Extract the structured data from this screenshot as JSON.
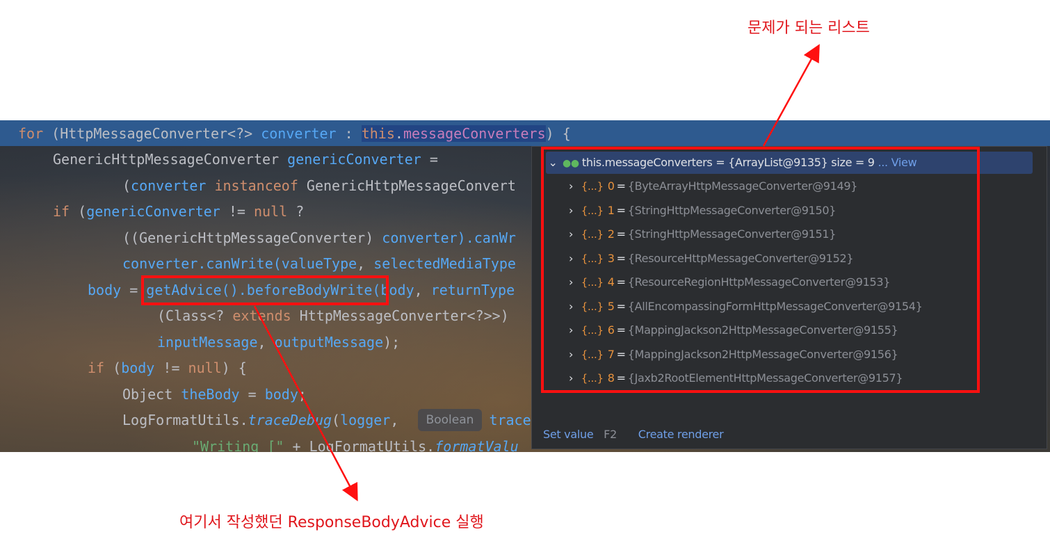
{
  "annotations": {
    "top_note": "문제가 되는 리스트",
    "bottom_note": "여기서 작성했던 ResponseBodyAdvice 실행"
  },
  "code": {
    "line1": {
      "kw": "for",
      "open": " (",
      "type": "HttpMessageConverter<?>",
      "var": " converter",
      "colon": " : ",
      "this": "this",
      "dot": ".",
      "field": "messageConverters",
      "close": ") {"
    },
    "line2": {
      "type": "GenericHttpMessageConverter",
      "var": " genericConverter",
      "rest": " ="
    },
    "line3": {
      "open": "(",
      "var": "converter",
      "kw": " instanceof",
      "type": " GenericHttpMessageConvert"
    },
    "line4": {
      "kw": "if",
      "open": " (",
      "var": "genericConverter",
      "op": " != ",
      "null": "null",
      "rest": " ?"
    },
    "line5": {
      "open": "((",
      "type": "GenericHttpMessageConverter",
      "close": ")",
      "var": " converter",
      "rest": ").canWr"
    },
    "line6": {
      "var": "converter",
      "rest": ".canWrite(",
      "arg1": "valueType",
      "comma": ", ",
      "arg2": "selectedMediaType"
    },
    "line7": {
      "var": "body",
      "eq": " = ",
      "call": "getAdvice().beforeBodyWrite(",
      "arg1": "body",
      "comma": ", ",
      "arg2": "returnType"
    },
    "line8": {
      "open": "(Class<? ",
      "kw": "extends",
      "type": " HttpMessageConverter<?>>)"
    },
    "line9": {
      "arg1": "inputMessage",
      "comma": ", ",
      "arg2": "outputMessage",
      "rest": ");"
    },
    "line10": {
      "kw": "if",
      "open": " (",
      "var": "body",
      "op": " != ",
      "null": "null",
      "rest": ") {"
    },
    "line11": {
      "type": "Object",
      "var": " theBody",
      "eq": " = ",
      "val": "body",
      "rest": ";"
    },
    "line12": {
      "type": "LogFormatUtils.",
      "fn": "traceDebug",
      "open": "(",
      "arg": "logger",
      "comma": ", ",
      "tail": "trace("
    },
    "line13": {
      "str": "\"Writing [\"",
      "op": " + ",
      "type": "LogFormatUtils.",
      "fn": "formatValu"
    }
  },
  "inlay_hint": "Boolean",
  "debugger": {
    "root": {
      "name": "this.messageConverters",
      "value": "= {ArrayList@9135} size = 9",
      "view_link": "... View"
    },
    "items": [
      {
        "index": "0",
        "value": "{ByteArrayHttpMessageConverter@9149}"
      },
      {
        "index": "1",
        "value": "{StringHttpMessageConverter@9150}"
      },
      {
        "index": "2",
        "value": "{StringHttpMessageConverter@9151}"
      },
      {
        "index": "3",
        "value": "{ResourceHttpMessageConverter@9152}"
      },
      {
        "index": "4",
        "value": "{ResourceRegionHttpMessageConverter@9153}"
      },
      {
        "index": "5",
        "value": "{AllEncompassingFormHttpMessageConverter@9154}"
      },
      {
        "index": "6",
        "value": "{MappingJackson2HttpMessageConverter@9155}"
      },
      {
        "index": "7",
        "value": "{MappingJackson2HttpMessageConverter@9156}"
      },
      {
        "index": "8",
        "value": "{Jaxb2RootElementHttpMessageConverter@9157}"
      }
    ],
    "item_icon": "{...}",
    "equals": "=",
    "footer": {
      "set_value": "Set value",
      "shortcut": "F2",
      "create_renderer": "Create renderer"
    }
  },
  "colors": {
    "annotation": "#e0161c",
    "highlight_box": "#ff1010",
    "selected_line": "#2e5a8f"
  }
}
